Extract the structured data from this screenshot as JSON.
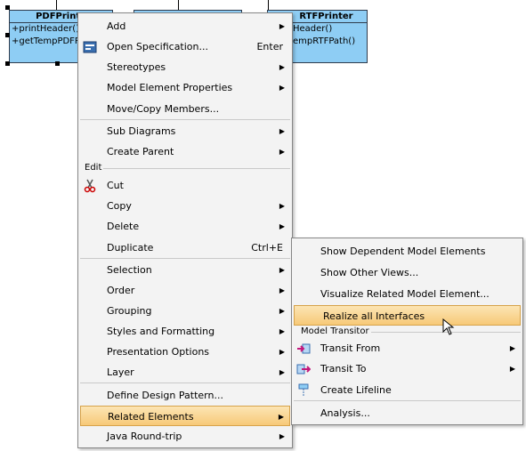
{
  "diagram": {
    "left_class": {
      "title": "PDFPrinte",
      "ops": [
        "+printHeader()",
        "+getTempPDFP"
      ]
    },
    "right_class": {
      "title": "RTFPrinter",
      "ops": [
        "Header()",
        "empRTFPath()"
      ]
    }
  },
  "context_menu": {
    "items": [
      {
        "label": "Add",
        "submenu": true
      },
      {
        "label": "Open Specification...",
        "shortcut": "Enter"
      },
      {
        "label": "Stereotypes",
        "submenu": true
      },
      {
        "label": "Model Element Properties",
        "submenu": true
      },
      {
        "label": "Move/Copy Members..."
      },
      {
        "label": "Sub Diagrams",
        "submenu": true
      },
      {
        "label": "Create Parent",
        "submenu": true
      },
      {
        "label": "Cut"
      },
      {
        "label": "Copy",
        "submenu": true
      },
      {
        "label": "Delete",
        "submenu": true
      },
      {
        "label": "Duplicate",
        "shortcut": "Ctrl+E"
      },
      {
        "label": "Selection",
        "submenu": true
      },
      {
        "label": "Order",
        "submenu": true
      },
      {
        "label": "Grouping",
        "submenu": true
      },
      {
        "label": "Styles and Formatting",
        "submenu": true
      },
      {
        "label": "Presentation Options",
        "submenu": true
      },
      {
        "label": "Layer",
        "submenu": true
      },
      {
        "label": "Define Design Pattern..."
      },
      {
        "label": "Related Elements",
        "submenu": true
      },
      {
        "label": "Java Round-trip",
        "submenu": true
      }
    ],
    "group_edit": "Edit"
  },
  "sub_menu": {
    "items": [
      {
        "label": "Show Dependent Model Elements"
      },
      {
        "label": "Show Other Views..."
      },
      {
        "label": "Visualize Related Model Element..."
      },
      {
        "label": "Realize all Interfaces"
      },
      {
        "label": "Transit From",
        "submenu": true
      },
      {
        "label": "Transit To",
        "submenu": true
      },
      {
        "label": "Create Lifeline"
      },
      {
        "label": "Analysis..."
      }
    ],
    "group_model_transitor": "Model Transitor"
  },
  "colors": {
    "class_fill": "#8ecdf4",
    "highlight": "#f7c978",
    "menu_bg": "#f3f3f3"
  }
}
